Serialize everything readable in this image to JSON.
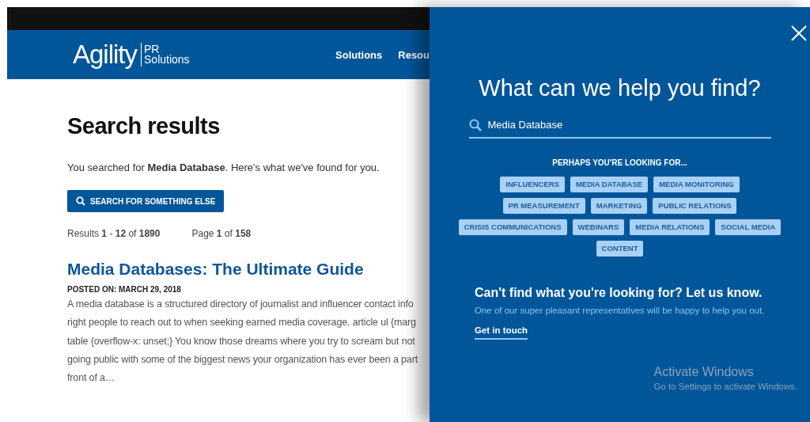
{
  "header": {
    "logo": {
      "name": "Agility",
      "line_1": "PR",
      "line_2": "Solutions"
    },
    "nav": [
      "Solutions",
      "Resou"
    ]
  },
  "results": {
    "title": "Search results",
    "summary": "You searched for **Media Database**. Here's what we've found for you.",
    "button": "SEARCH FOR SOMETHING ELSE",
    "count": "Results **1** - **12** of **1890**",
    "page": "Page **1** of **158**"
  },
  "article": {
    "title": "Media Databases: The Ultimate Guide",
    "posted": "POSTED ON: MARCH 29, 2018",
    "excerpt_lines": [
      "A media database is a structured directory of journalist and influencer contact info",
      "right people to reach out to when seeking earned media coverage. article ul {marg",
      "table {overflow-x: unset;} You know those dreams where you try to scream but not",
      "going public with some of the biggest news your organization has ever been a part",
      "front of a…"
    ]
  },
  "search_panel": {
    "title": "What can we help you find?",
    "search": {
      "value": "Media Database"
    },
    "suggestions_heading": "PERHAPS YOU'RE LOOKING FOR...",
    "suggestion_rows": [
      [
        "INFLUENCERS",
        "MEDIA DATABASE",
        "MEDIA MONITORING"
      ],
      [
        "PR MEASUREMENT",
        "MARKETING",
        "PUBLIC RELATIONS"
      ],
      [
        "CRISIS COMMUNICATIONS",
        "WEBINARS",
        "MEDIA RELATIONS",
        "SOCIAL MEDIA"
      ],
      [
        "CONTENT"
      ]
    ],
    "help_title": "Can't find what you're looking for? Let us know.",
    "help_text": "One of our super pleasant representatives will be happy to help you out.",
    "link": "Get in touch"
  },
  "os_notice": {
    "title": "Activate Windows",
    "text": "Go to Settings to activate Windows."
  }
}
